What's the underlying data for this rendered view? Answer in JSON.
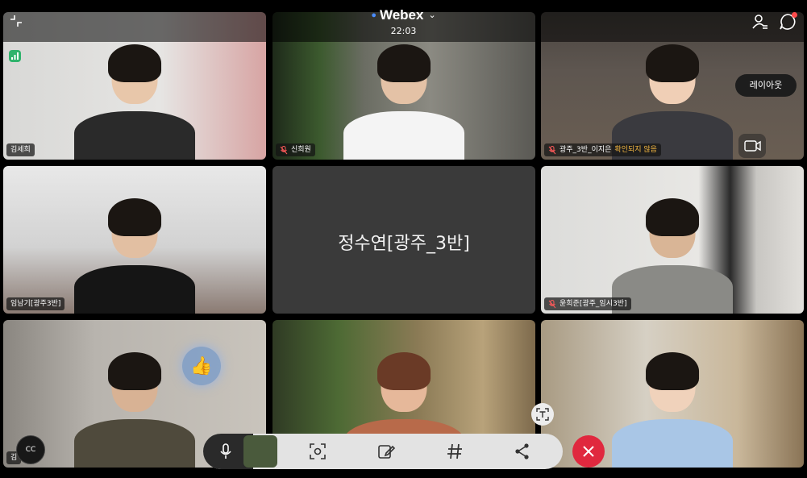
{
  "app": {
    "title": "Webex",
    "time": "22:03"
  },
  "participants": [
    {
      "name": "김세희",
      "muted": false
    },
    {
      "name": "신희원",
      "muted": true
    },
    {
      "name": "광주_3반_이지은",
      "muted": true,
      "status": "확인되지 않음"
    },
    {
      "name": "임남기[광주3반]",
      "muted": false
    },
    {
      "name": "정수연[광주_3반]",
      "muted": false,
      "video": false
    },
    {
      "name": "윤희준[광주_임시3반]",
      "muted": true
    },
    {
      "name": "김",
      "muted": false
    },
    {
      "name": "",
      "muted": false
    },
    {
      "name": "",
      "muted": false
    }
  ],
  "controls": {
    "layout_label": "레이아웃",
    "captions_label": "CC"
  },
  "icons": {
    "collapse": "collapse-icon",
    "participants": "participants-icon",
    "chat": "chat-icon",
    "network": "signal-icon",
    "camera": "camera-icon",
    "text_scan": "text-scan-icon",
    "mic": "microphone-icon",
    "screen_capture": "screen-capture-icon",
    "annotate": "annotate-icon",
    "hashtag": "hashtag-icon",
    "share": "share-icon",
    "leave": "close-icon",
    "reaction": "thumbs-up-icon"
  },
  "colors": {
    "leave": "#e0283e",
    "control_bar": "#e3e3e3",
    "status_warning": "#f5b841",
    "network_ok": "#2fb36c"
  }
}
